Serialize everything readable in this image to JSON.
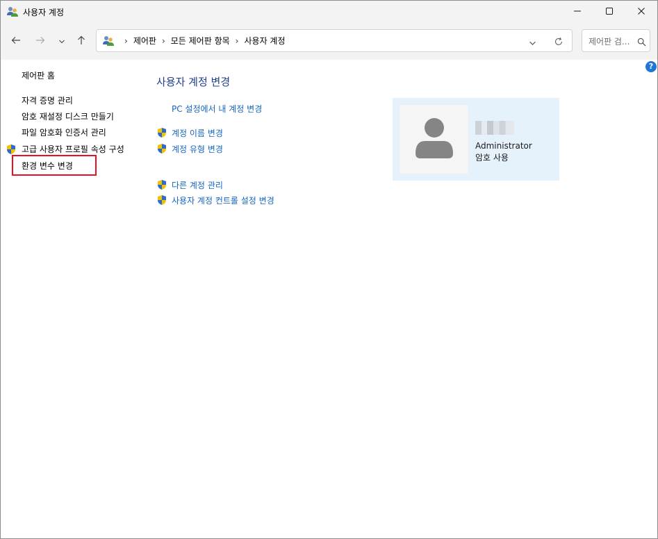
{
  "window": {
    "title": "사용자 계정",
    "icon": "user-accounts-icon",
    "controls": [
      "minimize-icon",
      "maximize-icon",
      "close-icon"
    ]
  },
  "nav": {
    "back": "arrow-left-icon",
    "forward": "arrow-right-icon",
    "recent": "chevron-down-icon",
    "up": "arrow-up-icon"
  },
  "address": {
    "icon": "user-accounts-icon",
    "breadcrumbs": [
      "제어판",
      "모든 제어판 항목",
      "사용자 계정"
    ],
    "dropdown": "chevron-down-icon",
    "refresh": "refresh-icon"
  },
  "search": {
    "placeholder": "제어판 검...",
    "icon": "search-icon"
  },
  "help": {
    "label": "?"
  },
  "sidebar": {
    "home": "제어판 홈",
    "items": [
      {
        "label": "자격 증명 관리",
        "shield": false
      },
      {
        "label": "암호 재설정 디스크 만들기",
        "shield": false
      },
      {
        "label": "파일 암호화 인증서 관리",
        "shield": false
      },
      {
        "label": "고급 사용자 프로필 속성 구성",
        "shield": true
      },
      {
        "label": "환경 변수 변경",
        "shield": false,
        "highlighted": true
      }
    ]
  },
  "main": {
    "heading": "사용자 계정 변경",
    "links_primary": [
      {
        "label": "PC 설정에서 내 계정 변경",
        "shield": false
      },
      {
        "label": "계정 이름 변경",
        "shield": true
      },
      {
        "label": "계정 유형 변경",
        "shield": true
      }
    ],
    "links_secondary": [
      {
        "label": "다른 계정 관리",
        "shield": true
      },
      {
        "label": "사용자 계정 컨트롤 설정 변경",
        "shield": true
      }
    ]
  },
  "account": {
    "avatar": "user-avatar-icon",
    "role": "Administrator",
    "password_status": "암호 사용"
  },
  "colors": {
    "link": "#1565c0",
    "heading": "#1e3f8a",
    "card_bg": "#e5f1fb",
    "highlight_border": "#e81123",
    "titlebar_bg": "#f3f3f3"
  }
}
